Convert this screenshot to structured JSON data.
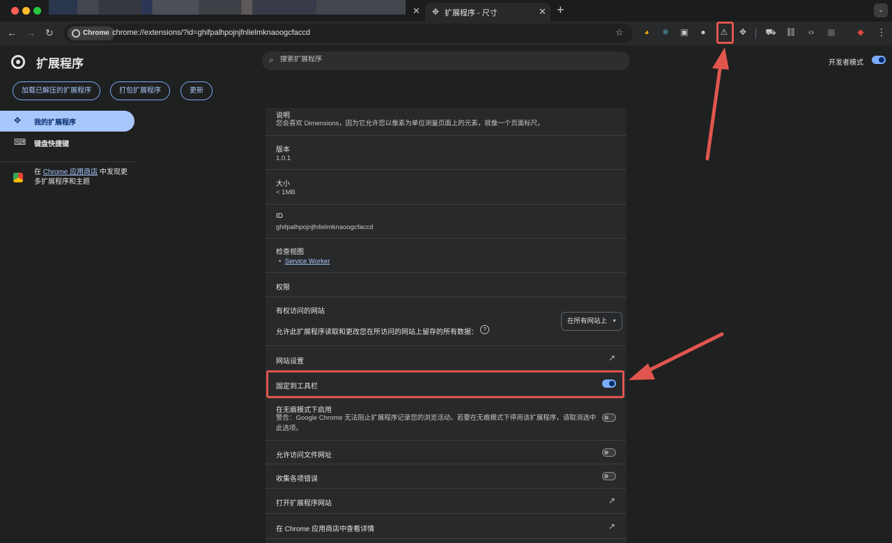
{
  "tabs": {
    "active_title": "扩展程序 - 尺寸"
  },
  "omnibox": {
    "chip_label": "Chrome",
    "url": "chrome://extensions/?id=ghifpalhpojnjfnlielmknaoogcfaccd"
  },
  "header": {
    "title": "扩展程序",
    "search_placeholder": "搜索扩展程序",
    "dev_mode_label": "开发者模式",
    "dev_mode_on": true,
    "buttons": [
      "加载已解压的扩展程序",
      "打包扩展程序",
      "更新"
    ]
  },
  "sidebar": {
    "items": [
      {
        "label": "我的扩展程序",
        "icon": "puzzle-icon",
        "active": true
      },
      {
        "label": "键盘快捷键",
        "icon": "keyboard-icon",
        "active": false
      }
    ],
    "store": {
      "prefix": "在 ",
      "link": "Chrome 应用商店",
      "suffix": " 中发现更多扩展程序和主题"
    }
  },
  "details": {
    "description_label": "说明",
    "description": "您会喜欢 Dimensions，因为它允许您以像素为单位测量页面上的元素，就像一个页面标尺。",
    "version_label": "版本",
    "version": "1.0.1",
    "size_label": "大小",
    "size": "< 1MB",
    "id_label": "ID",
    "id": "ghifpalhpojnjfnlielmknaoogcfaccd",
    "inspect_label": "检查视图",
    "inspect_link": "Service Worker",
    "permissions_label": "权限",
    "site_access_label": "有权访问的网站",
    "site_access_desc": "允许此扩展程序读取和更改您在所访问的网站上留存的所有数据：",
    "site_access_value": "在所有网站上",
    "site_settings": "网站设置",
    "pin_toolbar": "固定到工具栏",
    "pin_toolbar_on": true,
    "incognito_label": "在无痕模式下启用",
    "incognito_warning": "警告：Google Chrome 无法阻止扩展程序记录您的浏览活动。若要在无痕模式下停用该扩展程序，请取消选中此选项。",
    "incognito_on": false,
    "file_urls": "允许访问文件网址",
    "file_urls_on": false,
    "collect_errors": "收集各项错误",
    "collect_errors_on": false,
    "open_website": "打开扩展程序网站",
    "view_in_store": "在 Chrome 应用商店中查看详情"
  },
  "colors": {
    "annotation": "#e0564e",
    "accent": "#a8c7fa"
  }
}
